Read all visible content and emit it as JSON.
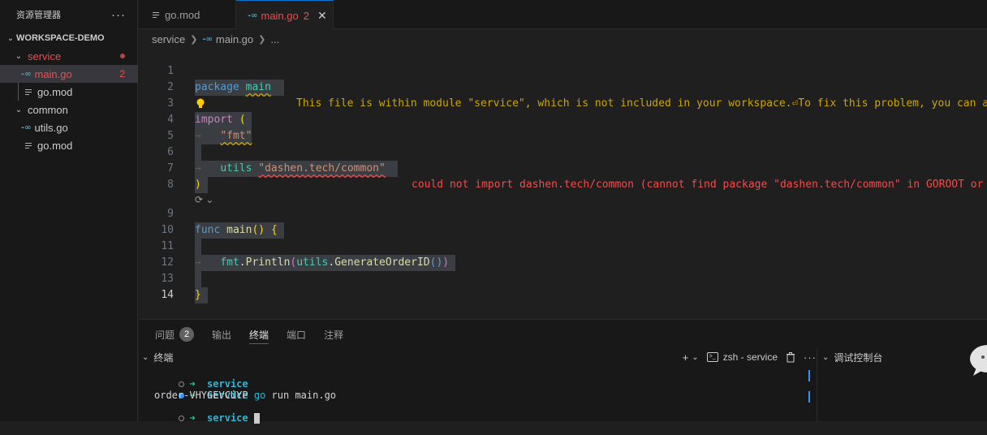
{
  "sidebar": {
    "title": "资源管理器",
    "more": "···",
    "workspace": "WORKSPACE-DEMO",
    "tree": [
      {
        "label": "service",
        "type": "folder"
      },
      {
        "label": "main.go",
        "type": "go",
        "badge": "2"
      },
      {
        "label": "go.mod",
        "type": "mod"
      },
      {
        "label": "common",
        "type": "folder"
      },
      {
        "label": "utils.go",
        "type": "go"
      },
      {
        "label": "go.mod",
        "type": "mod"
      }
    ]
  },
  "tabs": [
    {
      "label": "go.mod",
      "active": false
    },
    {
      "label": "main.go",
      "count": "2",
      "active": true,
      "close": "✕"
    }
  ],
  "breadcrumb": {
    "folder": "service",
    "file": "main.go",
    "ellipsis": "..."
  },
  "editor": {
    "line_numbers": [
      "1",
      "2",
      "3",
      "4",
      "5",
      "6",
      "7",
      "8",
      "9",
      "10",
      "11",
      "12",
      "13",
      "14"
    ],
    "l1": {
      "kw": "package",
      "name": "main"
    },
    "warning": "This file is within module \"service\", which is not included in your workspace.⏎To fix this problem, you can a",
    "l3": {
      "kw": "import",
      "paren": "("
    },
    "l4": {
      "str": "\"fmt\""
    },
    "l6": {
      "alias": "utils",
      "str": "\"dashen.tech/common\""
    },
    "error": "could not import dashen.tech/common (cannot find package \"dashen.tech/common\" in GOROOT or",
    "l7": {
      "paren": ")"
    },
    "l9": {
      "kw": "func",
      "name": "main",
      "parens": "()",
      "brace": "{"
    },
    "l11": {
      "pkg": "fmt",
      "dot1": ".",
      "fn": "Println",
      "open": "(",
      "obj": "utils",
      "dot2": ".",
      "fn2": "GenerateOrderID",
      "inner": "()",
      "close": ")"
    },
    "l13": {
      "brace": "}"
    }
  },
  "panel": {
    "tabs": [
      {
        "label": "问题",
        "badge": "2"
      },
      {
        "label": "输出"
      },
      {
        "label": "终端",
        "active": true
      },
      {
        "label": "端口"
      },
      {
        "label": "注释"
      }
    ],
    "terminal_title": "终端",
    "terminal_name": "zsh - service",
    "debug_title": "调试控制台",
    "terminal_lines": [
      {
        "arrow": "➜",
        "dir": "service",
        "cmd_go": "",
        "cmd": ""
      },
      {
        "arrow": "➜",
        "dir": "service",
        "cmd_go": "go",
        "cmd": "run main.go"
      },
      {
        "output": "order-VHYGEVCUYP"
      },
      {
        "arrow": "➜",
        "dir": "service"
      }
    ]
  },
  "colors": {
    "accent": "#0078d4",
    "error": "#f14c4c",
    "warning": "#cca700"
  }
}
